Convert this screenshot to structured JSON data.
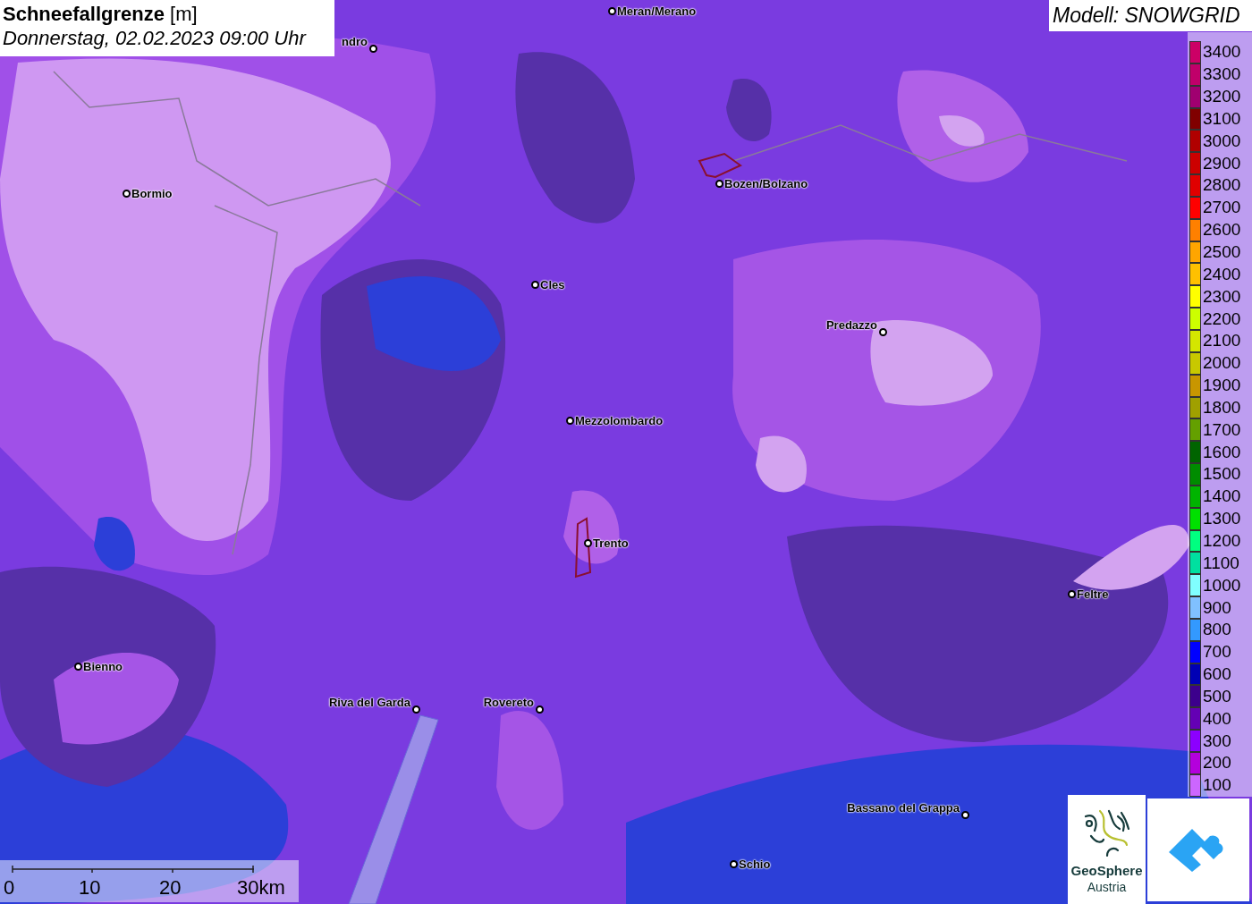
{
  "title": {
    "heading": "**Schneefallgrenze** [m]",
    "date": "Donnerstag, 02.02.2023 09:00 Uhr"
  },
  "model": "Modell: SNOWGRID",
  "places": [
    {
      "name": "Meran/Merano"
    },
    {
      "name": "ndro"
    },
    {
      "name": "Bormio"
    },
    {
      "name": "Bozen/Bolzano"
    },
    {
      "name": "Cles"
    },
    {
      "name": "Predazzo"
    },
    {
      "name": "Mezzolombardo"
    },
    {
      "name": "Trento"
    },
    {
      "name": "Feltre"
    },
    {
      "name": "Bienno"
    },
    {
      "name": "Riva del Garda"
    },
    {
      "name": "Rovereto"
    },
    {
      "name": "Bassano del Grappa"
    },
    {
      "name": "Schio"
    }
  ],
  "legend": [
    {
      "label": "3400",
      "color": "#cc0066"
    },
    {
      "label": "3300",
      "color": "#c0006a"
    },
    {
      "label": "3200",
      "color": "#a00070"
    },
    {
      "label": "3100",
      "color": "#800000"
    },
    {
      "label": "3000",
      "color": "#b00000"
    },
    {
      "label": "2900",
      "color": "#cc0000"
    },
    {
      "label": "2800",
      "color": "#e00000"
    },
    {
      "label": "2700",
      "color": "#ff0000"
    },
    {
      "label": "2600",
      "color": "#ff8000"
    },
    {
      "label": "2500",
      "color": "#ffa500"
    },
    {
      "label": "2400",
      "color": "#ffc000"
    },
    {
      "label": "2300",
      "color": "#ffff00"
    },
    {
      "label": "2200",
      "color": "#ccff00"
    },
    {
      "label": "2100",
      "color": "#d4e600"
    },
    {
      "label": "2000",
      "color": "#c8c800"
    },
    {
      "label": "1900",
      "color": "#c89600"
    },
    {
      "label": "1800",
      "color": "#a0a000"
    },
    {
      "label": "1700",
      "color": "#64a000"
    },
    {
      "label": "1600",
      "color": "#006400"
    },
    {
      "label": "1500",
      "color": "#008c00"
    },
    {
      "label": "1400",
      "color": "#00b400"
    },
    {
      "label": "1300",
      "color": "#00e000"
    },
    {
      "label": "1200",
      "color": "#00ff80"
    },
    {
      "label": "1100",
      "color": "#00e0a0"
    },
    {
      "label": "1000",
      "color": "#80ffff"
    },
    {
      "label": "900",
      "color": "#80c0ff"
    },
    {
      "label": "800",
      "color": "#3399ff"
    },
    {
      "label": "700",
      "color": "#0000ff"
    },
    {
      "label": "600",
      "color": "#0000b4"
    },
    {
      "label": "500",
      "color": "#3c008c"
    },
    {
      "label": "400",
      "color": "#6400b4"
    },
    {
      "label": "300",
      "color": "#8c00ff"
    },
    {
      "label": "200",
      "color": "#b400dc"
    },
    {
      "label": "100",
      "color": "#cc66ff"
    }
  ],
  "scale": [
    "0",
    "10",
    "20",
    "30km"
  ],
  "logo": {
    "line1": "GeoSphere",
    "line2": "Austria"
  }
}
